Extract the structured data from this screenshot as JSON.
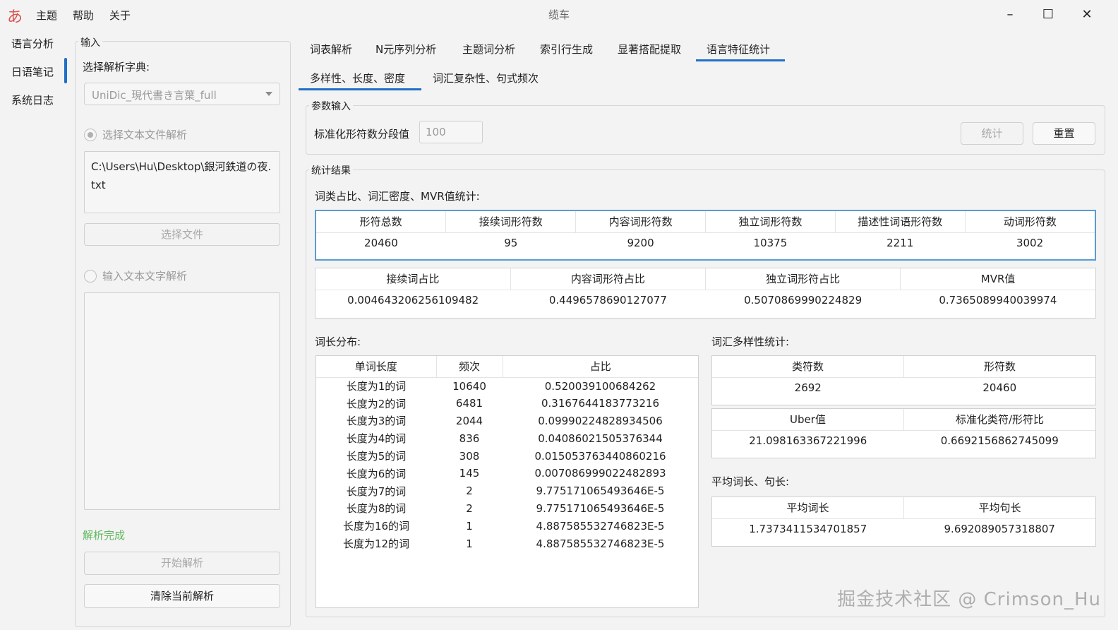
{
  "window": {
    "title": "缆车",
    "app_icon": "あ",
    "controls": {
      "minimize": "–",
      "maximize": "☐",
      "close": "✕"
    }
  },
  "menu": [
    "主题",
    "帮助",
    "关于"
  ],
  "nav": [
    "语言分析",
    "日语笔记",
    "系统日志"
  ],
  "input": {
    "group_title": "输入",
    "dict_label": "选择解析字典:",
    "dict_value": "UniDic_現代書き言葉_full",
    "radio_file": "选择文本文件解析",
    "file_path": "C:\\Users\\Hu\\Desktop\\銀河鉄道の夜.txt",
    "choose_file_btn": "选择文件",
    "radio_text": "输入文本文字解析",
    "status": "解析完成",
    "start_btn": "开始解析",
    "clear_btn": "清除当前解析"
  },
  "tabs": [
    "词表解析",
    "N元序列分析",
    "主题词分析",
    "索引行生成",
    "显著搭配提取",
    "语言特征统计"
  ],
  "subtabs": [
    "多样性、长度、密度",
    "词汇复杂性、句式频次"
  ],
  "params": {
    "group_title": "参数输入",
    "label": "标准化形符数分段值",
    "value": "100",
    "stat_btn": "统计",
    "reset_btn": "重置"
  },
  "results": {
    "group_title": "统计结果",
    "section1_title": "词类占比、词汇密度、MVR值统计:",
    "table1": {
      "headers": [
        "形符总数",
        "接续词形符数",
        "内容词形符数",
        "独立词形符数",
        "描述性词语形符数",
        "动词形符数"
      ],
      "row": [
        "20460",
        "95",
        "9200",
        "10375",
        "2211",
        "3002"
      ]
    },
    "table2": {
      "headers": [
        "接续词占比",
        "内容词形符占比",
        "独立词形符占比",
        "MVR值"
      ],
      "row": [
        "0.004643206256109482",
        "0.4496578690127077",
        "0.5070869990224829",
        "0.7365089940039974"
      ]
    },
    "dist_title": "词长分布:",
    "dist_table": {
      "headers": [
        "单词长度",
        "频次",
        "占比"
      ],
      "rows": [
        [
          "长度为1的词",
          "10640",
          "0.520039100684262"
        ],
        [
          "长度为2的词",
          "6481",
          "0.3167644183773216"
        ],
        [
          "长度为3的词",
          "2044",
          "0.09990224828934506"
        ],
        [
          "长度为4的词",
          "836",
          "0.04086021505376344"
        ],
        [
          "长度为5的词",
          "308",
          "0.015053763440860216"
        ],
        [
          "长度为6的词",
          "145",
          "0.007086999022482893"
        ],
        [
          "长度为7的词",
          "2",
          "9.775171065493646E-5"
        ],
        [
          "长度为8的词",
          "2",
          "9.775171065493646E-5"
        ],
        [
          "长度为16的词",
          "1",
          "4.887585532746823E-5"
        ],
        [
          "长度为12的词",
          "1",
          "4.887585532746823E-5"
        ]
      ]
    },
    "diversity_title": "词汇多样性统计:",
    "diversity_table1": {
      "headers": [
        "类符数",
        "形符数"
      ],
      "row": [
        "2692",
        "20460"
      ]
    },
    "diversity_table2": {
      "headers": [
        "Uber值",
        "标准化类符/形符比"
      ],
      "row": [
        "21.098163367221996",
        "0.6692156862745099"
      ]
    },
    "avg_title": "平均词长、句长:",
    "avg_table": {
      "headers": [
        "平均词长",
        "平均句长"
      ],
      "row": [
        "1.7373411534701857",
        "9.692089057318807"
      ]
    }
  },
  "watermark": "掘金技术社区 @ Crimson_Hu"
}
